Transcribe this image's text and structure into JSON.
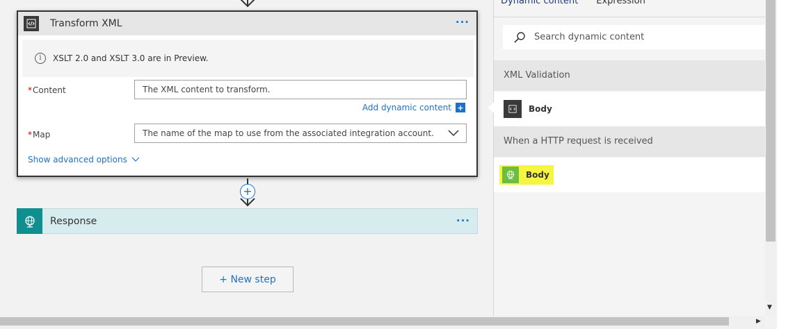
{
  "designer": {
    "transform_card": {
      "title": "Transform XML",
      "more_label": "···",
      "info_text": "XSLT 2.0 and XSLT 3.0 are in Preview.",
      "content_label": "Content",
      "content_placeholder": "The XML content to transform.",
      "add_dynamic_label": "Add dynamic content",
      "map_label": "Map",
      "map_placeholder": "The name of the map to use from the associated integration account.",
      "advanced_label": "Show advanced options",
      "required_mark": "*"
    },
    "response_card": {
      "title": "Response",
      "more_label": "···"
    },
    "new_step_label": "+ New step"
  },
  "dynamic_panel": {
    "tabs": [
      "Dynamic content",
      "Expression"
    ],
    "search_placeholder": "Search dynamic content",
    "sections": [
      {
        "title": "XML Validation",
        "items": [
          {
            "label": "Body",
            "icon": "xml-icon"
          }
        ]
      },
      {
        "title": "When a HTTP request is received",
        "items": [
          {
            "label": "Body",
            "icon": "http-globe-icon",
            "highlighted": true
          }
        ]
      }
    ]
  },
  "colors": {
    "accent": "#1d72c7",
    "response_bg": "#d6ecef",
    "response_icon": "#0f8f8f",
    "highlight": "#f5f542"
  }
}
